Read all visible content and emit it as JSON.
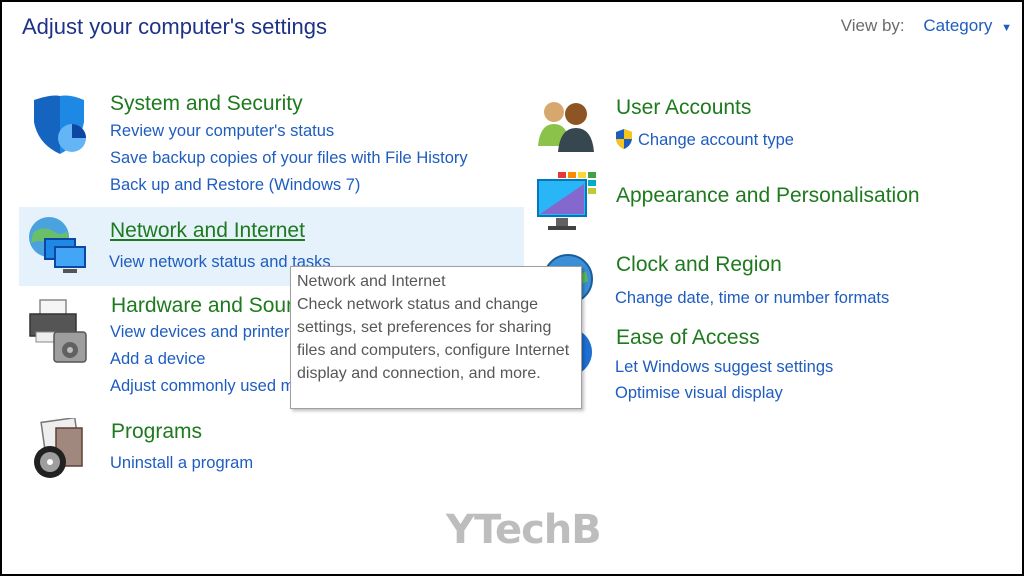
{
  "header": {
    "title": "Adjust your computer's settings",
    "view_by_label": "View by:",
    "view_by_value": "Category"
  },
  "categories": {
    "system": {
      "title": "System and Security",
      "links": [
        "Review your computer's status",
        "Save backup copies of your files with File History",
        "Back up and Restore (Windows 7)"
      ],
      "icon": "shield-icon"
    },
    "network": {
      "title": "Network and Internet",
      "links": [
        "View network status and tasks"
      ],
      "icon": "network-globe-icon"
    },
    "hardware": {
      "title": "Hardware and Sound",
      "links": [
        "View devices and printers",
        "Add a device",
        "Adjust commonly used mobility settings"
      ],
      "icon": "printer-icon"
    },
    "programs": {
      "title": "Programs",
      "links": [
        "Uninstall a program"
      ],
      "icon": "programs-disc-icon"
    },
    "users": {
      "title": "User Accounts",
      "links": [
        "Change account type"
      ],
      "icon": "users-icon"
    },
    "appearance": {
      "title": "Appearance and Personalisation",
      "links": [],
      "icon": "monitor-color-icon"
    },
    "clock": {
      "title": "Clock and Region",
      "links": [
        "Change date, time or number formats"
      ],
      "icon": "clock-globe-icon"
    },
    "ease": {
      "title": "Ease of Access",
      "links": [
        "Let Windows suggest settings",
        "Optimise visual display"
      ],
      "icon": "ease-of-access-icon"
    }
  },
  "tooltip": {
    "title": "Network and Internet",
    "body": "Check network status and change settings, set preferences for sharing files and computers, configure Internet display and connection, and more."
  },
  "watermark": "YTechB",
  "colors": {
    "title_blue": "#1e3287",
    "category_green": "#1e7a1e",
    "link_blue": "#1e5dbf",
    "highlight": "#e5f1fb"
  }
}
